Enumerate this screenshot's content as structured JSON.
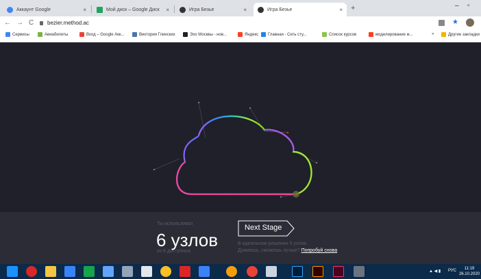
{
  "tabs": [
    {
      "title": "Аккаунт Google",
      "close": "×"
    },
    {
      "title": "Мой диск – Google Диск",
      "close": "×"
    },
    {
      "title": "Игра Безье",
      "close": "×"
    },
    {
      "title": "Игра Безье",
      "close": "×"
    }
  ],
  "new_tab": "+",
  "window": {
    "minimize": "–",
    "maximize": "▫"
  },
  "nav": {
    "back": "←",
    "forward": "→",
    "reload": "C",
    "url": "bezier.method.ac"
  },
  "bookmarks": [
    "Сервисы",
    "Авиабилеты",
    "Вход – Google Акк...",
    "Виктория Глинских",
    "Эхо Москвы - нов...",
    "Яндекс",
    "Главная - Сеть сту...",
    "Список курсов",
    "моделирование ж...",
    "»",
    "Другие закладки"
  ],
  "footer": {
    "used_label": "Ты использовал",
    "nodes_count": "6 узлов",
    "of_available": "из 6 доступных",
    "next_stage": "Next Stage",
    "hint_line1": "В идеальном решении 5 узлов.",
    "hint_line2": "Думаешь, сможешь лучше?",
    "retry_link": "Попробуй снова"
  },
  "taskbar": {
    "lang": "РУС",
    "time": "11:19",
    "date": "26.10.2020"
  },
  "icons": [
    "windows-start-icon",
    "power-icon",
    "folder-icon",
    "word-icon",
    "excel-icon",
    "icon",
    "icon",
    "icon",
    "icon",
    "icon",
    "icon",
    "chrome-icon",
    "icon",
    "photoshop-icon",
    "illustrator-icon",
    "indesign-icon",
    "icon"
  ]
}
